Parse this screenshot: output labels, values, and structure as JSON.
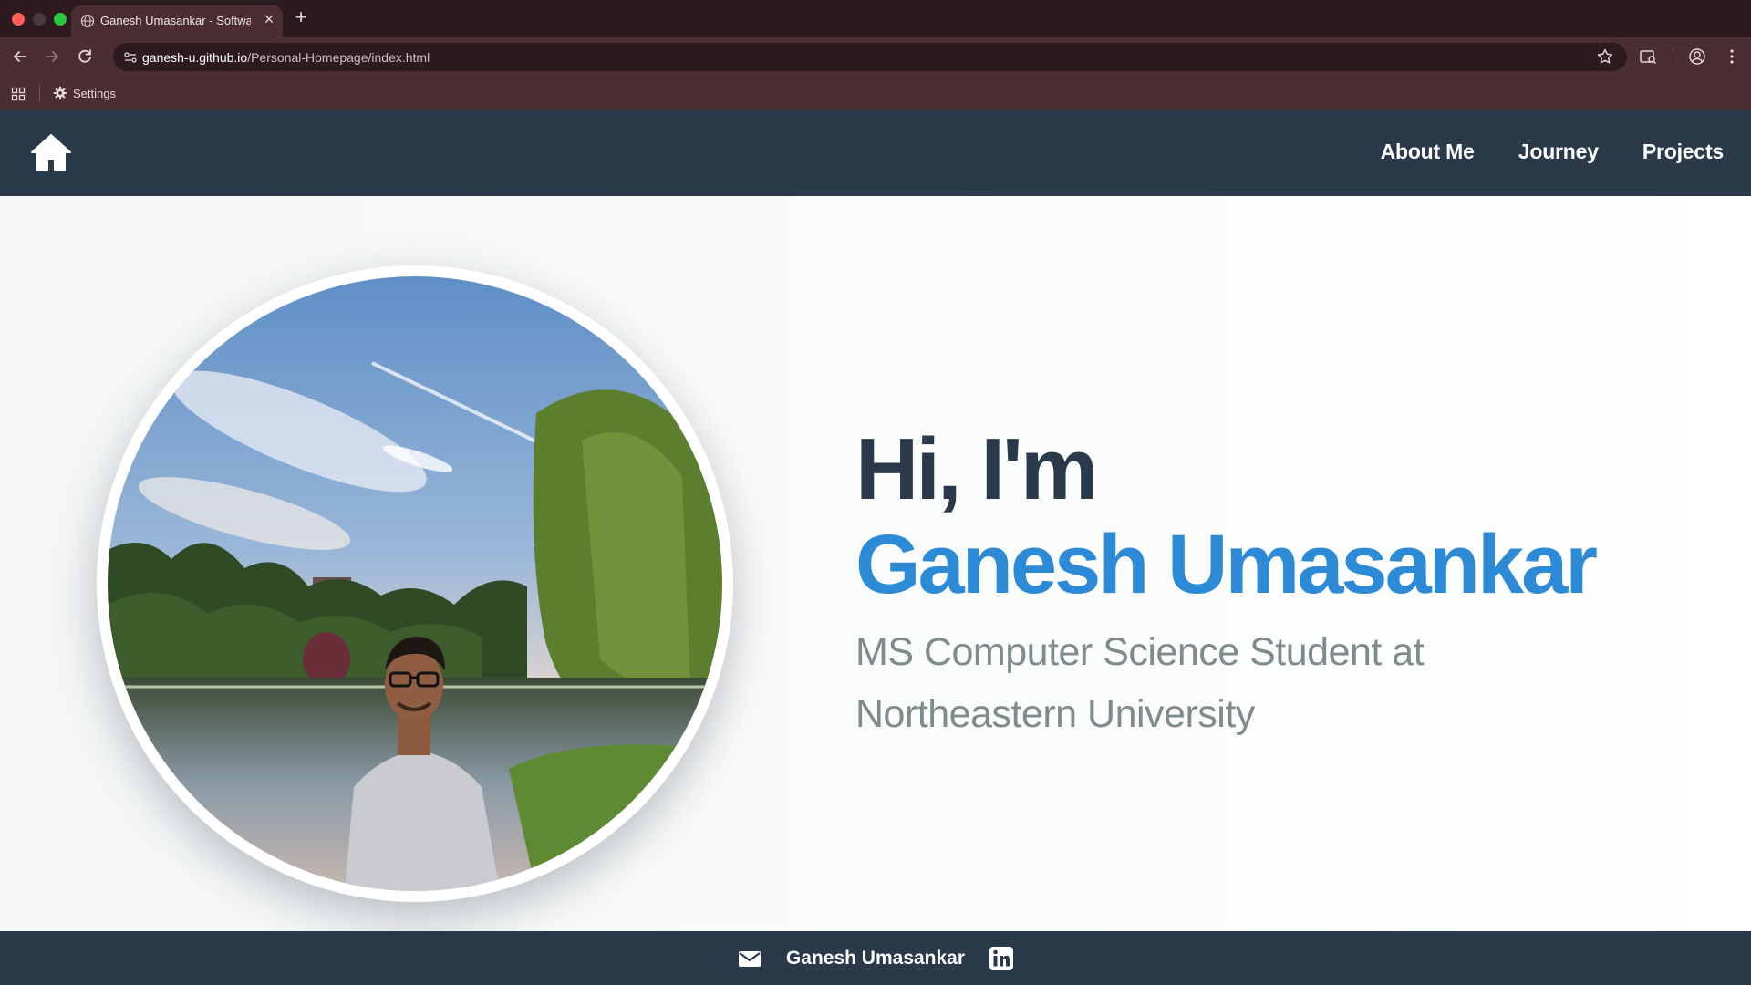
{
  "browser": {
    "tab_title": "Ganesh Umasankar - Software Engineer",
    "close_label": "×",
    "newtab_label": "+",
    "url_host": "ganesh-u.github.io",
    "url_path": "/Personal-Homepage/index.html",
    "bookmark_settings": "Settings"
  },
  "nav": {
    "links": [
      "About Me",
      "Journey",
      "Projects"
    ]
  },
  "hero": {
    "greeting": "Hi, I'm",
    "name": "Ganesh Umasankar",
    "subtitle": "MS Computer Science Student at Northeastern University"
  },
  "footer": {
    "name": "Ganesh Umasankar"
  },
  "colors": {
    "navbar": "#2b3a4a",
    "accent": "#2d8ad6",
    "subtitle": "#7f8c8d"
  },
  "icons": [
    "home-icon",
    "mail-icon",
    "linkedin-icon",
    "gear-icon",
    "star-icon",
    "profile-icon"
  ]
}
